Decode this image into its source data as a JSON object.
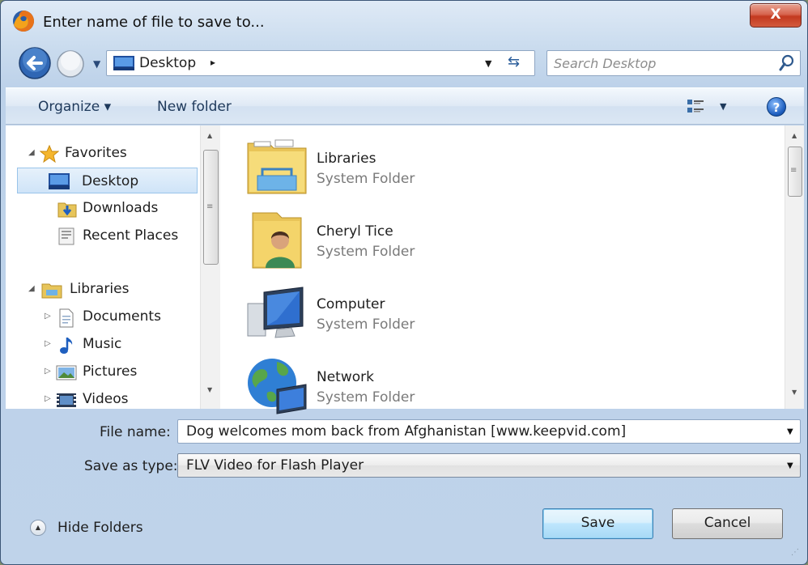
{
  "window": {
    "title": "Enter name of file to save to...",
    "close_label": "X"
  },
  "address": {
    "location": "Desktop",
    "crumb_arrow": "▸",
    "search_placeholder": "Search Desktop"
  },
  "toolbar": {
    "organize_label": "Organize ▾",
    "new_folder_label": "New folder",
    "help_label": "?"
  },
  "nav": {
    "favorites_label": "Favorites",
    "desktop_label": "Desktop",
    "downloads_label": "Downloads",
    "recent_label": "Recent Places",
    "libraries_label": "Libraries",
    "documents_label": "Documents",
    "music_label": "Music",
    "pictures_label": "Pictures",
    "videos_label": "Videos"
  },
  "files": [
    {
      "name": "Libraries",
      "type": "System Folder"
    },
    {
      "name": "Cheryl Tice",
      "type": "System Folder"
    },
    {
      "name": "Computer",
      "type": "System Folder"
    },
    {
      "name": "Network",
      "type": "System Folder"
    }
  ],
  "form": {
    "file_name_label": "File name:",
    "file_name_value": "Dog welcomes mom back from Afghanistan [www.keepvid.com]",
    "save_type_label": "Save as type:",
    "save_type_value": "FLV Video for Flash Player"
  },
  "footer": {
    "hide_folders_label": "Hide Folders",
    "save_label": "Save",
    "cancel_label": "Cancel"
  },
  "colors": {
    "accent": "#3c7fb1",
    "selection": "#cfe4f8",
    "close": "#c3391f"
  }
}
